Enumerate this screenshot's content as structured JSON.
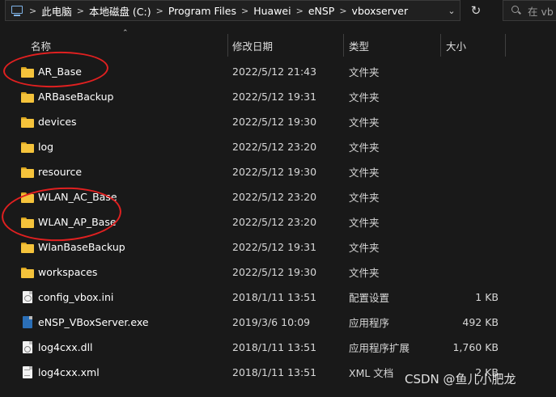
{
  "address_bar": {
    "breadcrumbs": [
      "此电脑",
      "本地磁盘 (C:)",
      "Program Files",
      "Huawei",
      "eNSP",
      "vboxserver"
    ],
    "search_placeholder": "在 vb"
  },
  "columns": {
    "name": "名称",
    "date": "修改日期",
    "type": "类型",
    "size": "大小"
  },
  "files": [
    {
      "name": "AR_Base",
      "date": "2022/5/12 21:43",
      "type": "文件夹",
      "size": "",
      "icon": "folder-icon"
    },
    {
      "name": "ARBaseBackup",
      "date": "2022/5/12 19:31",
      "type": "文件夹",
      "size": "",
      "icon": "folder-icon"
    },
    {
      "name": "devices",
      "date": "2022/5/12 19:30",
      "type": "文件夹",
      "size": "",
      "icon": "folder-icon"
    },
    {
      "name": "log",
      "date": "2022/5/12 23:20",
      "type": "文件夹",
      "size": "",
      "icon": "folder-icon"
    },
    {
      "name": "resource",
      "date": "2022/5/12 19:30",
      "type": "文件夹",
      "size": "",
      "icon": "folder-icon"
    },
    {
      "name": "WLAN_AC_Base",
      "date": "2022/5/12 23:20",
      "type": "文件夹",
      "size": "",
      "icon": "folder-icon"
    },
    {
      "name": "WLAN_AP_Base",
      "date": "2022/5/12 23:20",
      "type": "文件夹",
      "size": "",
      "icon": "folder-icon"
    },
    {
      "name": "WlanBaseBackup",
      "date": "2022/5/12 19:31",
      "type": "文件夹",
      "size": "",
      "icon": "folder-icon"
    },
    {
      "name": "workspaces",
      "date": "2022/5/12 19:30",
      "type": "文件夹",
      "size": "",
      "icon": "folder-icon"
    },
    {
      "name": "config_vbox.ini",
      "date": "2018/1/11 13:51",
      "type": "配置设置",
      "size": "1 KB",
      "icon": "config-file-icon"
    },
    {
      "name": "eNSP_VBoxServer.exe",
      "date": "2019/3/6 10:09",
      "type": "应用程序",
      "size": "492 KB",
      "icon": "exe-file-icon"
    },
    {
      "name": "log4cxx.dll",
      "date": "2018/1/11 13:51",
      "type": "应用程序扩展",
      "size": "1,760 KB",
      "icon": "dll-file-icon"
    },
    {
      "name": "log4cxx.xml",
      "date": "2018/1/11 13:51",
      "type": "XML 文档",
      "size": "2 KB",
      "icon": "xml-file-icon"
    }
  ],
  "watermark": "CSDN @鱼儿小肥龙",
  "colors": {
    "background": "#191919",
    "folder": "#f5c33b",
    "annotation": "#e02020"
  }
}
